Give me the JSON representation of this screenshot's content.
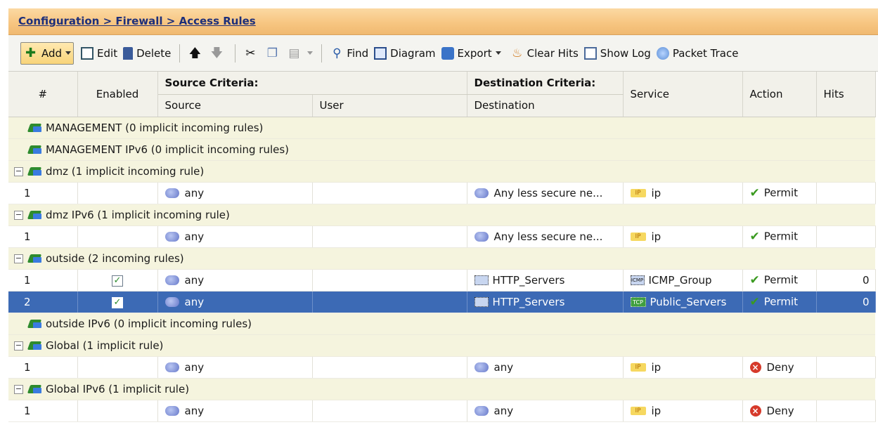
{
  "breadcrumb": "Configuration > Firewall > Access Rules",
  "toolbar": {
    "add": "Add",
    "edit": "Edit",
    "delete": "Delete",
    "find": "Find",
    "diagram": "Diagram",
    "export": "Export",
    "clear_hits": "Clear Hits",
    "show_log": "Show Log",
    "packet_trace": "Packet Trace"
  },
  "columns": {
    "num": "#",
    "enabled": "Enabled",
    "source_criteria": "Source Criteria:",
    "source": "Source",
    "user": "User",
    "destination_criteria": "Destination Criteria:",
    "destination": "Destination",
    "service": "Service",
    "action": "Action",
    "hits": "Hits"
  },
  "groups": [
    {
      "label": "MANAGEMENT (0 implicit incoming rules)",
      "collapsible": false
    },
    {
      "label": "MANAGEMENT IPv6 (0 implicit incoming rules)",
      "collapsible": false
    },
    {
      "label": "dmz (1 implicit incoming rule)",
      "collapsible": true,
      "rules": [
        {
          "num": "1",
          "enabled": false,
          "source": "any",
          "user": "",
          "destination": "Any less secure ne...",
          "service": "ip",
          "action": "Permit",
          "hits": ""
        }
      ]
    },
    {
      "label": "dmz IPv6 (1 implicit incoming rule)",
      "collapsible": true,
      "rules": [
        {
          "num": "1",
          "enabled": false,
          "source": "any",
          "user": "",
          "destination": "Any less secure ne...",
          "service": "ip",
          "action": "Permit",
          "hits": ""
        }
      ]
    },
    {
      "label": "outside (2 incoming rules)",
      "collapsible": true,
      "rules": [
        {
          "num": "1",
          "enabled": true,
          "source": "any",
          "user": "",
          "destination": "HTTP_Servers",
          "service": "ICMP_Group",
          "action": "Permit",
          "hits": "0"
        },
        {
          "num": "2",
          "enabled": true,
          "selected": true,
          "source": "any",
          "user": "",
          "destination": "HTTP_Servers",
          "service": "Public_Servers",
          "action": "Permit",
          "hits": "0"
        }
      ]
    },
    {
      "label": "outside IPv6 (0 implicit incoming rules)",
      "collapsible": false
    },
    {
      "label": "Global (1 implicit rule)",
      "collapsible": true,
      "rules": [
        {
          "num": "1",
          "enabled": false,
          "source": "any",
          "user": "",
          "destination": "any",
          "service": "ip",
          "action": "Deny",
          "hits": ""
        }
      ]
    },
    {
      "label": "Global IPv6 (1 implicit rule)",
      "collapsible": true,
      "rules": [
        {
          "num": "1",
          "enabled": false,
          "source": "any",
          "user": "",
          "destination": "any",
          "service": "ip",
          "action": "Deny",
          "hits": ""
        }
      ]
    }
  ],
  "icons": {
    "tcp_label": "TCP",
    "ip_label": "IP",
    "icmp_label": "ICMP"
  },
  "colors": {
    "header_orange": "#f7c682",
    "selected_row": "#3c6ab5",
    "group_row": "#f5f4de",
    "permit_green": "#3a9a20",
    "deny_red": "#d63a2b"
  }
}
